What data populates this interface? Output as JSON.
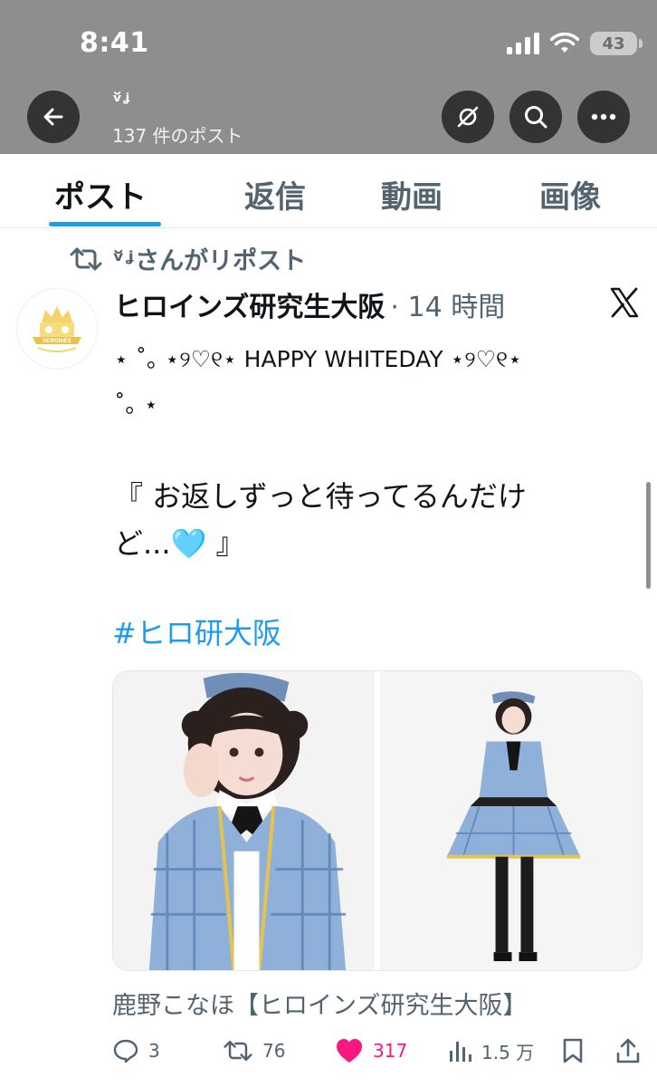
{
  "status_bar": {
    "time": "8:41",
    "battery": "43"
  },
  "header": {
    "profile_name": "ᵛ̆ᶨ",
    "post_count": "137 件のポスト"
  },
  "tabs": [
    {
      "label": "ポスト",
      "active": true
    },
    {
      "label": "返信",
      "active": false
    },
    {
      "label": "動画",
      "active": false
    },
    {
      "label": "画像",
      "active": false
    }
  ],
  "post": {
    "repost_text": "ᵛ̆ᶨさんがリポスト",
    "author_name": "ヒロインズ研究生大阪",
    "time": "· 14 時間",
    "text_line1": "⋆ ˚｡ ⋆୨♡୧⋆ HAPPY WHITEDAY ⋆୨♡୧⋆",
    "text_line2": "˚｡ ⋆",
    "quote_line1": "『 お返しずっと待ってるんだけ",
    "quote_line2": "ど...🩵 』",
    "hashtag": "#ヒロ研大阪",
    "avatar_label": "HEROINES",
    "caption": "鹿野こなほ【ヒロインズ研究生大阪】",
    "actions": {
      "replies": "3",
      "reposts": "76",
      "likes": "317",
      "views": "1.5 万"
    }
  },
  "colors": {
    "accent": "#1d9bf0",
    "like": "#f91880",
    "secondary_text": "#536471",
    "header_bg": "#8e8e8e"
  }
}
